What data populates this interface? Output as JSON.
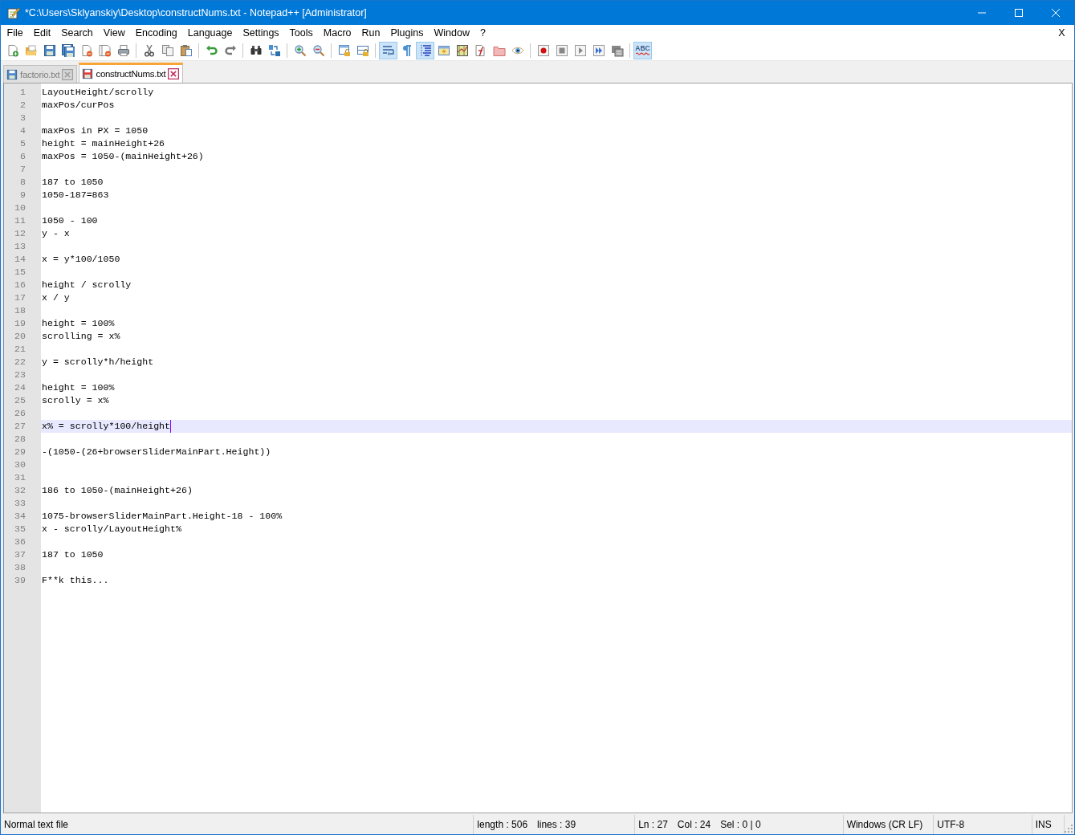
{
  "window": {
    "title": "*C:\\Users\\Sklyanskiy\\Desktop\\constructNums.txt - Notepad++ [Administrator]"
  },
  "menu": {
    "items": [
      "File",
      "Edit",
      "Search",
      "View",
      "Encoding",
      "Language",
      "Settings",
      "Tools",
      "Macro",
      "Run",
      "Plugins",
      "Window",
      "?"
    ],
    "close_document": "X"
  },
  "toolbar": {
    "groups": [
      [
        {
          "pressed": false
        },
        {
          "pressed": false
        },
        {
          "pressed": false
        },
        {
          "pressed": false
        },
        {
          "pressed": false
        },
        {
          "pressed": false
        },
        {
          "pressed": false
        }
      ],
      [
        {
          "pressed": false
        },
        {
          "pressed": false
        },
        {
          "pressed": false
        }
      ],
      [
        {
          "pressed": false
        },
        {
          "pressed": false
        }
      ],
      [
        {
          "pressed": false
        },
        {
          "pressed": false
        }
      ],
      [
        {
          "pressed": false
        },
        {
          "pressed": false
        }
      ],
      [
        {
          "pressed": false
        },
        {
          "pressed": false
        }
      ],
      [
        {
          "pressed": true
        },
        {
          "pressed": false
        },
        {
          "pressed": true
        },
        {
          "pressed": false
        },
        {
          "pressed": false
        },
        {
          "pressed": false
        },
        {
          "pressed": false
        },
        {
          "pressed": false
        }
      ],
      [
        {
          "pressed": false
        },
        {
          "pressed": false
        },
        {
          "pressed": false
        },
        {
          "pressed": false
        },
        {
          "pressed": false
        }
      ],
      [
        {
          "pressed": true,
          "label": "ABC"
        }
      ]
    ]
  },
  "tabs": [
    {
      "label": "factorio.txt",
      "selected": false,
      "modified": false
    },
    {
      "label": "constructNums.txt",
      "selected": true,
      "modified": true
    }
  ],
  "editor": {
    "lines": [
      {
        "number": "1",
        "text": "LayoutHeight/scrolly",
        "current": false
      },
      {
        "number": "2",
        "text": "maxPos/curPos",
        "current": false
      },
      {
        "number": "3",
        "current": false
      },
      {
        "number": "4",
        "text": "maxPos in PX = 1050",
        "current": false
      },
      {
        "number": "5",
        "text": "height = mainHeight+26",
        "current": false
      },
      {
        "number": "6",
        "text": "maxPos = 1050-(mainHeight+26)",
        "current": false
      },
      {
        "number": "7",
        "current": false
      },
      {
        "number": "8",
        "text": "187 to 1050",
        "current": false
      },
      {
        "number": "9",
        "text": "1050-187=863",
        "current": false
      },
      {
        "number": "10",
        "current": false
      },
      {
        "number": "11",
        "text": "1050 - 100",
        "current": false
      },
      {
        "number": "12",
        "text": "y - x",
        "current": false
      },
      {
        "number": "13",
        "current": false
      },
      {
        "number": "14",
        "text": "x = y*100/1050",
        "current": false
      },
      {
        "number": "15",
        "current": false
      },
      {
        "number": "16",
        "text": "height / scrolly",
        "current": false
      },
      {
        "number": "17",
        "text": "x / y",
        "current": false
      },
      {
        "number": "18",
        "current": false
      },
      {
        "number": "19",
        "text": "height = 100%",
        "current": false
      },
      {
        "number": "20",
        "text": "scrolling = x%",
        "current": false
      },
      {
        "number": "21",
        "current": false
      },
      {
        "number": "22",
        "text": "y = scrolly*h/height",
        "current": false
      },
      {
        "number": "23",
        "current": false
      },
      {
        "number": "24",
        "text": "height = 100%",
        "current": false
      },
      {
        "number": "25",
        "text": "scrolly = x%",
        "current": false
      },
      {
        "number": "26",
        "current": false
      },
      {
        "number": "27",
        "text": "x% = scrolly*100/height",
        "current": true
      },
      {
        "number": "28",
        "current": false
      },
      {
        "number": "29",
        "text": "-(1050-(26+browserSliderMainPart.Height))",
        "current": false
      },
      {
        "number": "30",
        "current": false
      },
      {
        "number": "31",
        "current": false
      },
      {
        "number": "32",
        "text": "186 to 1050-(mainHeight+26)",
        "current": false
      },
      {
        "number": "33",
        "current": false
      },
      {
        "number": "34",
        "text": "1075-browserSliderMainPart.Height-18 - 100%",
        "current": false
      },
      {
        "number": "35",
        "text": "x - scrolly/LayoutHeight%",
        "current": false
      },
      {
        "number": "36",
        "current": false
      },
      {
        "number": "37",
        "text": "187 to 1050",
        "current": false
      },
      {
        "number": "38",
        "current": false
      },
      {
        "number": "39",
        "text": "F**k this...",
        "current": false
      }
    ]
  },
  "status_bar": {
    "sections": [
      {
        "items": [
          "Normal text file"
        ]
      },
      {
        "items": [
          "length : 506",
          "lines : 39"
        ]
      },
      {
        "items": [
          "Ln : 27",
          "Col : 24",
          "Sel : 0 | 0"
        ]
      },
      {
        "items": [
          "Windows (CR LF)"
        ]
      },
      {
        "items": [
          "UTF-8"
        ]
      },
      {
        "items": [
          "INS"
        ]
      }
    ]
  }
}
